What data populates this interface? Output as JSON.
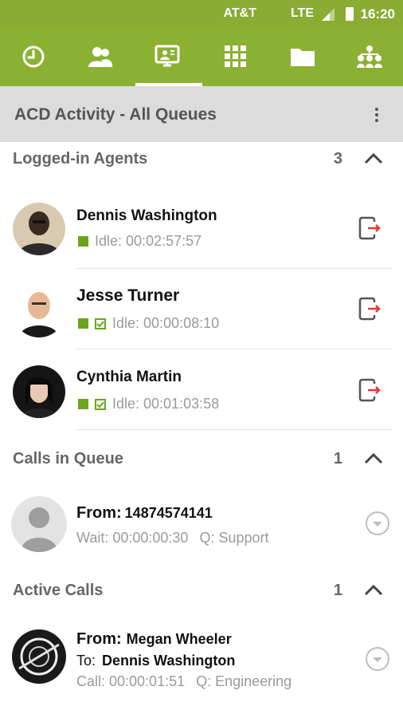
{
  "status_bar": {
    "carrier": "AT&T",
    "network": "LTE",
    "time": "16:20"
  },
  "toolbar": {
    "tabs": [
      {
        "icon": "history-icon"
      },
      {
        "icon": "contacts-icon"
      },
      {
        "icon": "acd-monitor-icon",
        "active": true
      },
      {
        "icon": "dialpad-icon"
      },
      {
        "icon": "folder-icon"
      },
      {
        "icon": "hierarchy-icon"
      }
    ],
    "accent": "#8bb132"
  },
  "header": {
    "title": "ACD Activity - All Queues"
  },
  "agents_section": {
    "title": "Logged-in Agents",
    "count": "3"
  },
  "agents": [
    {
      "name": "Dennis Washington",
      "status": "Idle: 00:02:57:57",
      "checked": false
    },
    {
      "name": "Jesse Turner",
      "status": "Idle: 00:00:08:10",
      "checked": true
    },
    {
      "name": "Cynthia Martin",
      "status": "Idle: 00:01:03:58",
      "checked": true
    }
  ],
  "queue_section": {
    "title": "Calls in Queue",
    "count": "1"
  },
  "queue_calls": [
    {
      "from_label": "From:",
      "from": "14874574141",
      "wait": "Wait: 00:00:00:30",
      "queue": "Q: Support"
    }
  ],
  "active_section": {
    "title": "Active Calls",
    "count": "1"
  },
  "active_calls": [
    {
      "from_label": "From:",
      "from": "Megan Wheeler",
      "to_label": "To:",
      "to": "Dennis Washington",
      "call": "Call: 00:00:01:51",
      "queue": "Q: Engineering"
    }
  ],
  "colors": {
    "status_green": "#6aa51f",
    "logout_red": "#e53935"
  }
}
